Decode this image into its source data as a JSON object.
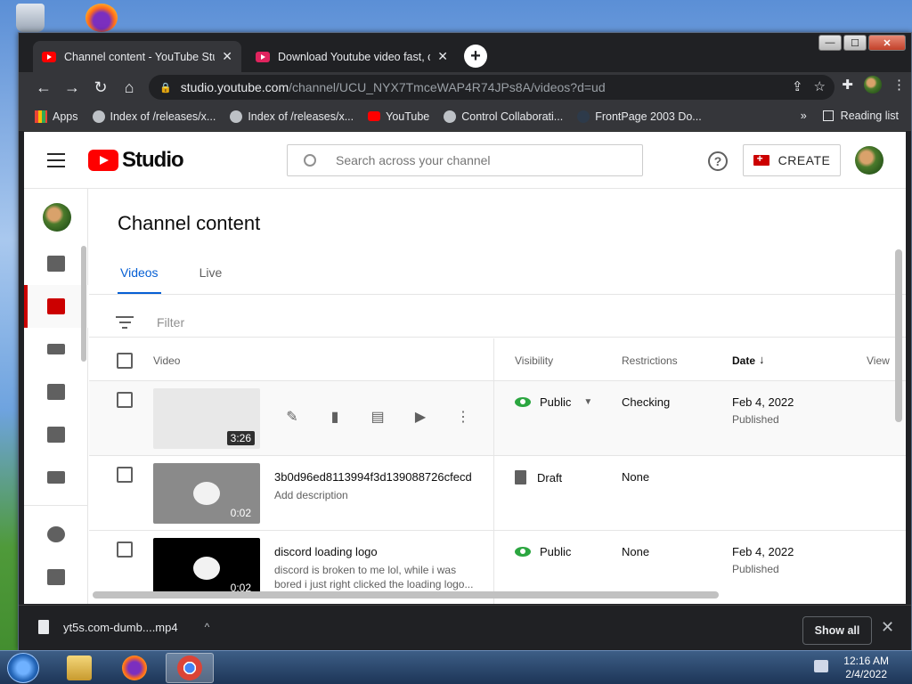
{
  "desktop": {},
  "browser": {
    "tabs": [
      {
        "title": "Channel content - YouTube Studio",
        "active": true
      },
      {
        "title": "Download Youtube video fast, convert...",
        "active": false
      }
    ],
    "window_controls": {
      "minimize": "—",
      "maximize": "☐",
      "close": "✕"
    },
    "new_tab": "+",
    "address": {
      "host": "studio.youtube.com",
      "path": "/channel/UCU_NYX7TmceWAP4R74JPs8A/videos?d=ud"
    },
    "bookmarks": [
      {
        "label": "Apps",
        "icon": "apps-grid-icon"
      },
      {
        "label": "Index of /releases/x...",
        "icon": "globe-icon"
      },
      {
        "label": "Index of /releases/x...",
        "icon": "globe-icon"
      },
      {
        "label": "YouTube",
        "icon": "youtube-icon"
      },
      {
        "label": "Control Collaborati...",
        "icon": "globe-icon"
      },
      {
        "label": "FrontPage 2003 Do...",
        "icon": "page-icon"
      }
    ],
    "bookmarks_overflow": "»",
    "reading_list": "Reading list"
  },
  "studio": {
    "logo_text": "Studio",
    "search_placeholder": "Search across your channel",
    "help": "?",
    "create_label": "CREATE",
    "page_title": "Channel content",
    "tabs": [
      {
        "label": "Videos",
        "active": true
      },
      {
        "label": "Live",
        "active": false
      }
    ],
    "filter_placeholder": "Filter",
    "columns": {
      "video": "Video",
      "visibility": "Visibility",
      "restrictions": "Restrictions",
      "date": "Date",
      "date_sort": "↓",
      "views": "View"
    },
    "rows": [
      {
        "title": "",
        "description": "",
        "duration": "3:26",
        "visibility": "Public",
        "restrictions": "Checking",
        "date": "Feb 4, 2022",
        "status": "Published"
      },
      {
        "title": "3b0d96ed8113994f3d139088726cfecd",
        "description": "Add description",
        "duration": "0:02",
        "visibility": "Draft",
        "restrictions": "None",
        "date": "",
        "status": ""
      },
      {
        "title": "discord loading logo",
        "description": "discord is broken to me lol, while i was bored i just right clicked the loading logo...",
        "duration": "0:02",
        "visibility": "Public",
        "restrictions": "None",
        "date": "Feb 4, 2022",
        "status": "Published"
      }
    ]
  },
  "download_bar": {
    "filename": "yt5s.com-dumb....mp4",
    "chevron": "^",
    "show_all": "Show all",
    "close": "✕"
  },
  "taskbar": {
    "time": "12:16 AM",
    "date": "2/4/2022"
  },
  "colors": {
    "yt_red": "#ff0000",
    "accent_blue": "#065fd4",
    "public_green": "#2ba640",
    "chrome_dark": "#202124"
  }
}
